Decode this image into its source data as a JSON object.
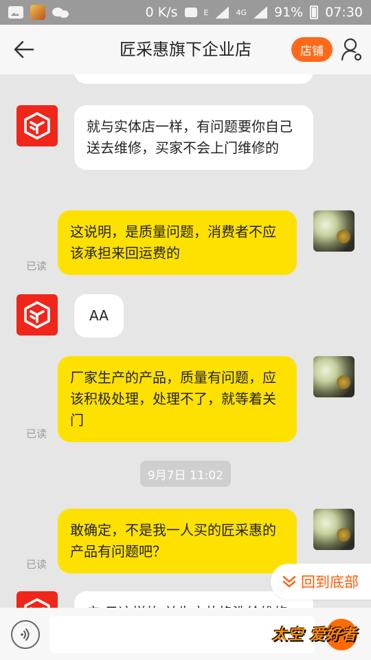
{
  "status_bar": {
    "speed": "0 K/s",
    "network": "4G",
    "battery": "91%",
    "time": "07:30"
  },
  "header": {
    "title": "匠采惠旗下企业店",
    "shop_button": "店铺"
  },
  "messages": [
    {
      "side": "left",
      "text": "就与实体店一样，有问题要你自己送去维修，买家不会上门维修的"
    },
    {
      "side": "right",
      "text": "这说明，是质量问题，消费者不应该承担来回运费的",
      "status": "已读"
    },
    {
      "side": "left",
      "text": "AA"
    },
    {
      "side": "right",
      "text": "厂家生产的产品，质量有问题，应该积极处理，处理不了，就等着关门",
      "status": "已读"
    },
    {
      "side": "right",
      "text": "敢确定，不是我一人买的匠采惠的产品有问题吧？",
      "status": "已读"
    },
    {
      "side": "left",
      "text": "亲 目这样的 关先方的换洗给维修"
    }
  ],
  "timestamp": "9月7日 11:02",
  "back_to_bottom": "回到底部",
  "watermark": "太空 爱好者",
  "colors": {
    "accent": "#ff6a1a",
    "my_bubble": "#ffe100",
    "shop_avatar": "#f0261a"
  }
}
